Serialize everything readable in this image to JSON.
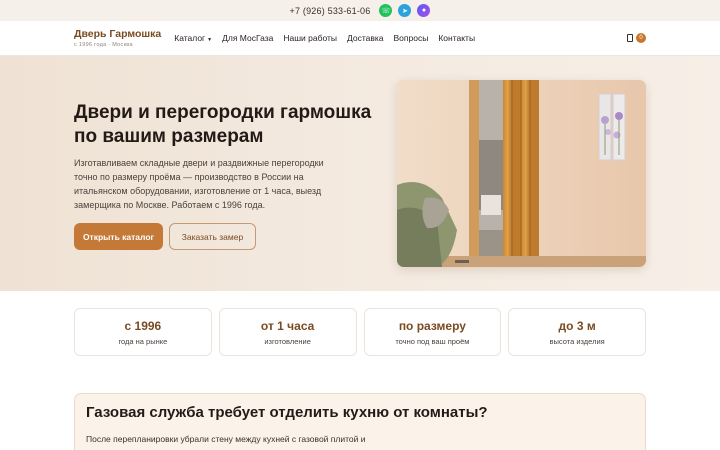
{
  "topbar": {
    "phone": "+7 (926) 533-61-06",
    "messengers": [
      "whatsapp-icon",
      "telegram-icon",
      "max-icon"
    ]
  },
  "header": {
    "logo_name": "Дверь Гармошка",
    "logo_sub": "с 1996 года · Москва",
    "nav": [
      "Каталог",
      "Для МосГаза",
      "Наши работы",
      "Доставка",
      "Вопросы",
      "Контакты"
    ],
    "cart_count": "0"
  },
  "hero": {
    "title": "Двери и перегородки гармошка по вашим размерам",
    "text": "Изготавливаем складные двери и раздвижные перегородки точно по размеру проёма — производство в России на итальянском оборудовании, изготовление от 1 часа, выезд замерщика по Москве. Работаем с 1996 года.",
    "primary_button": "Открыть каталог",
    "secondary_button": "Заказать замер"
  },
  "stats": [
    {
      "value": "с 1996",
      "label": "года на рынке"
    },
    {
      "value": "от 1 часа",
      "label": "изготовление"
    },
    {
      "value": "по размеру",
      "label": "точно под ваш проём"
    },
    {
      "value": "до 3 м",
      "label": "высота изделия"
    }
  ],
  "gas": {
    "title": "Газовая служба требует отделить кухню от комнаты?",
    "text": "После перепланировки убрали стену между кухней с газовой плитой и"
  },
  "colors": {
    "accent": "#c47a36",
    "brand_dark": "#7a4a22",
    "hero_bg": "#f3e9df"
  }
}
